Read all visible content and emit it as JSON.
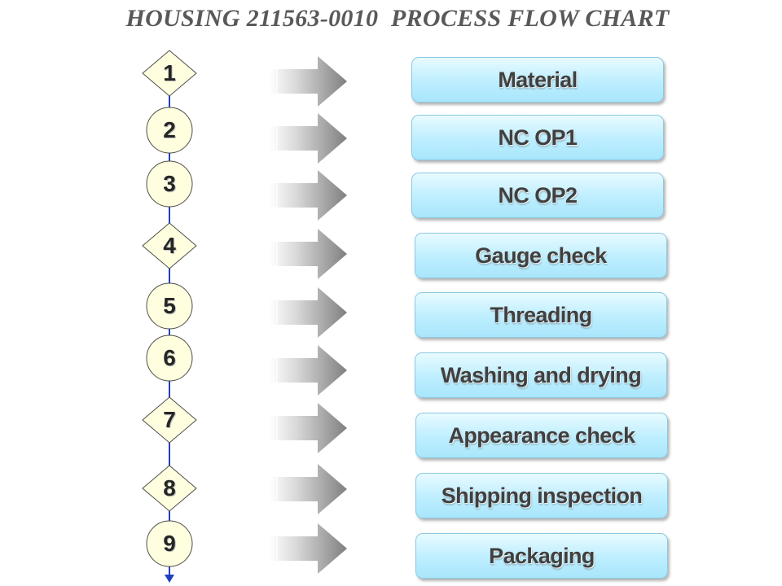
{
  "title": "HOUSING 211563-0010  PROCESS FLOW CHART",
  "colors": {
    "node_fill": "#ffffe0",
    "node_stroke": "#4d4d4d",
    "connector": "#1f3fbf",
    "box_fill": "#bdeeff",
    "arrow": "#8c8c8c"
  },
  "steps": [
    {
      "num": "1",
      "shape": "diamond",
      "label": "Material"
    },
    {
      "num": "2",
      "shape": "circle",
      "label": "NC OP1"
    },
    {
      "num": "3",
      "shape": "circle",
      "label": "NC OP2"
    },
    {
      "num": "4",
      "shape": "diamond",
      "label": "Gauge check"
    },
    {
      "num": "5",
      "shape": "circle",
      "label": "Threading"
    },
    {
      "num": "6",
      "shape": "circle",
      "label": "Washing and drying"
    },
    {
      "num": "7",
      "shape": "diamond",
      "label": "Appearance check"
    },
    {
      "num": "8",
      "shape": "diamond",
      "label": "Shipping inspection"
    },
    {
      "num": "9",
      "shape": "circle",
      "label": "Packaging"
    }
  ]
}
